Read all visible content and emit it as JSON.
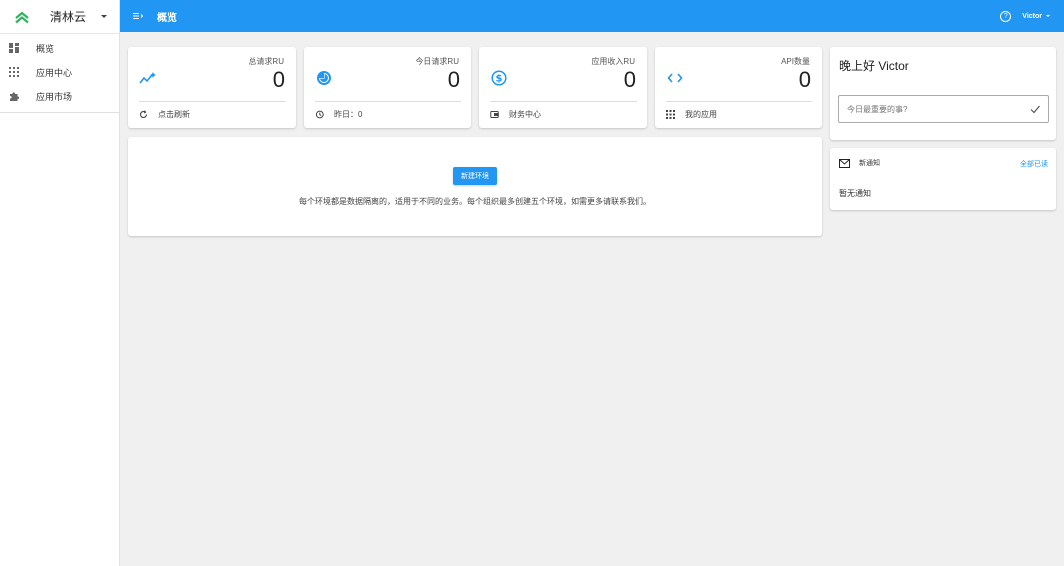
{
  "brand": {
    "name": "清林云"
  },
  "sidebar": {
    "items": [
      {
        "label": "概览",
        "icon": "dashboard-icon"
      },
      {
        "label": "应用中心",
        "icon": "grid-icon"
      },
      {
        "label": "应用市场",
        "icon": "puzzle-icon"
      }
    ]
  },
  "topbar": {
    "title": "概览",
    "user": "Victor",
    "help_glyph": "?"
  },
  "stats": [
    {
      "label": "总请求RU",
      "value": "0",
      "foot": "点击刷新",
      "icon": "trend-icon",
      "foot_icon": "refresh-icon"
    },
    {
      "label": "今日请求RU",
      "value": "0",
      "foot": "昨日：0",
      "icon": "pie-icon",
      "foot_icon": "history-icon"
    },
    {
      "label": "应用收入RU",
      "value": "0",
      "foot": "财务中心",
      "icon": "dollar-icon",
      "foot_icon": "wallet-icon"
    },
    {
      "label": "API数量",
      "value": "0",
      "foot": "我的应用",
      "icon": "code-icon",
      "foot_icon": "apps-icon"
    }
  ],
  "environment": {
    "button": "新建环境",
    "description": "每个环境都是数据隔离的，适用于不同的业务。每个组织最多创建五个环境，如需更多请联系我们。"
  },
  "greeting": {
    "title": "晚上好 Victor",
    "placeholder": "今日最重要的事?"
  },
  "notice": {
    "title": "新通知",
    "all": "全部已读",
    "empty": "暂无通知"
  },
  "colors": {
    "primary": "#2196f3",
    "brand_green": "#2db55d"
  }
}
